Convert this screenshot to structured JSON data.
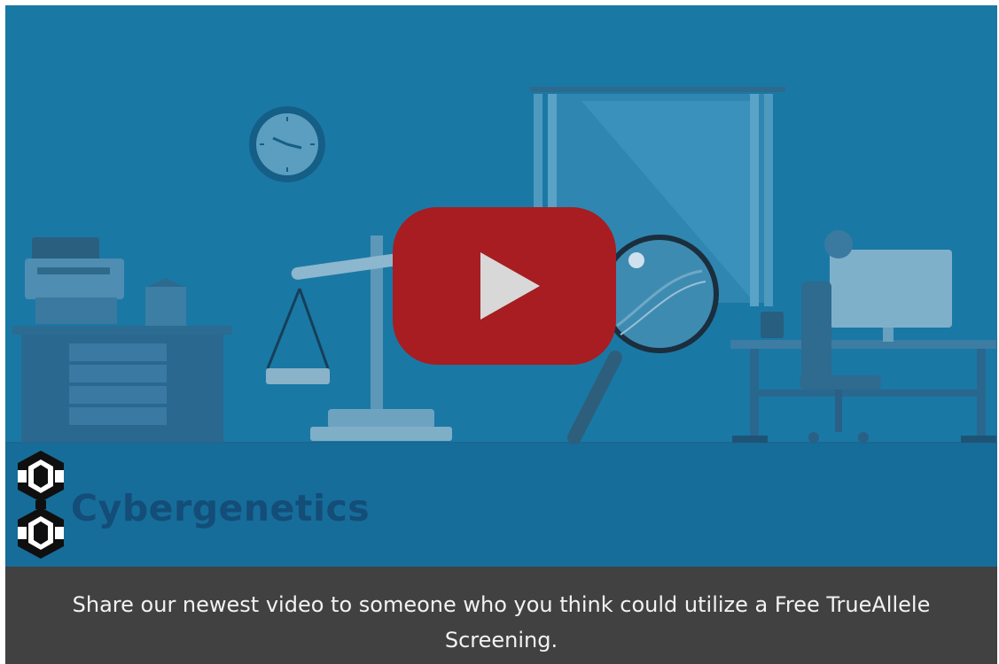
{
  "video": {
    "brand_name": "Cybergenetics",
    "play_label": "Play video",
    "icons": {
      "play": "play-icon",
      "logo": "cybergenetics-logo-icon"
    },
    "colors": {
      "background": "#1a78a5",
      "play_button": "#a71d22",
      "brand_text": "#134d78"
    }
  },
  "caption": {
    "text": "Share our newest video to someone who you think could utilize a Free TrueAllele Screening."
  }
}
